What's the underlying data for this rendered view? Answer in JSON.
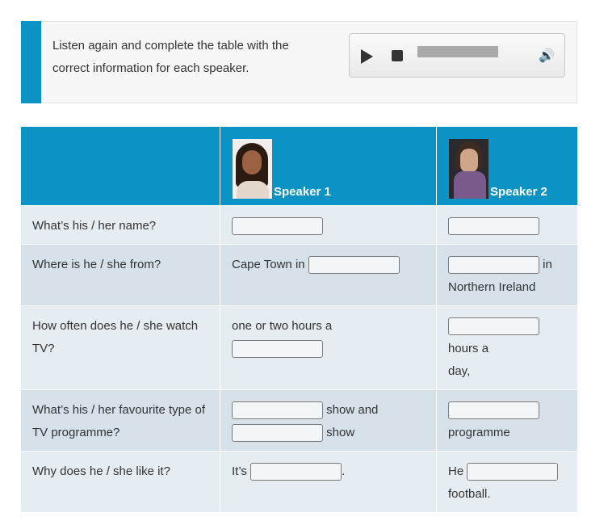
{
  "instructions": {
    "line1": "Listen again and complete the table with the",
    "line2": "correct information for each speaker."
  },
  "player": {
    "play_icon": "play-icon",
    "stop_icon": "stop-icon",
    "volume_icon": "volume-icon"
  },
  "table": {
    "headers": [
      "",
      "Speaker 1",
      "Speaker 2"
    ],
    "questions": [
      "What’s his / her name?",
      "Where is he / she from?",
      "How often does he / she watch TV?",
      "What’s his / her favourite type of TV programme?",
      "Why does he / she like it?"
    ],
    "speaker1": {
      "from_prefix": "Cape Town in",
      "often_text": "one or two hours a",
      "fav_show1": "show and",
      "fav_show2": "show",
      "why_prefix": "It’s",
      "why_suffix": "."
    },
    "speaker2": {
      "from_suffix": "in",
      "from_place": "Northern Ireland",
      "often_suffix": "hours a",
      "often_day": "day,",
      "fav_suffix": "programme",
      "why_prefix": "He",
      "why_suffix": "football."
    }
  },
  "colors": {
    "accent": "#0a93c4",
    "row_light": "#e5ecf2",
    "row_dark": "#d6e1ea"
  }
}
